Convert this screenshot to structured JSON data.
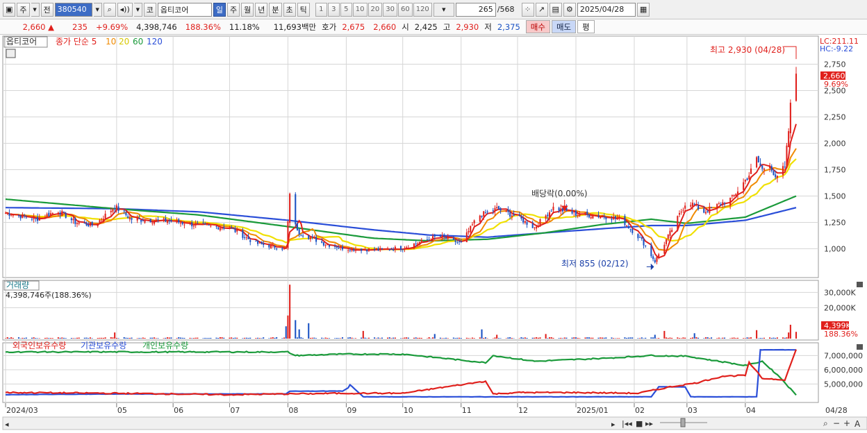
{
  "toolbar": {
    "type_label": "주",
    "prev_label": "전",
    "stock_code": "380540",
    "market_label": "코",
    "stock_name": "옵티코어",
    "periods": [
      "일",
      "주",
      "월",
      "년",
      "분",
      "초",
      "틱"
    ],
    "active_period": "일",
    "intervals": [
      "1",
      "3",
      "5",
      "10",
      "20",
      "30",
      "60",
      "120"
    ],
    "count_display": "265",
    "count_total": "/568",
    "date": "2025/04/28"
  },
  "quote": {
    "price": "2,660",
    "change": "235",
    "change_pct": "+9.69%",
    "volume": "4,398,746",
    "volume_ratio": "188.36%",
    "turnover": "11.18%",
    "amount": "11,693백만",
    "bid_label": "호가",
    "bid": "2,675",
    "ask": "2,660",
    "open_label": "시",
    "open": "2,425",
    "high_label": "고",
    "high": "2,930",
    "low_label": "저",
    "low": "2,375",
    "buy_label": "매수",
    "sell_label": "매도",
    "avg_label": "평"
  },
  "chart_data": [
    {
      "type": "candlestick",
      "title": "옵티코어",
      "legend": [
        {
          "name": "종가 단순 5",
          "color": "#e0201c"
        },
        {
          "name": "10",
          "color": "#f08a00"
        },
        {
          "name": "20",
          "color": "#f0e000"
        },
        {
          "name": "60",
          "color": "#1a9a3a"
        },
        {
          "name": "120",
          "color": "#2a4ed8"
        }
      ],
      "ylim": [
        740,
        2990
      ],
      "yticks": [
        "1,000",
        "1,250",
        "1,500",
        "1,750",
        "2,000",
        "2,250",
        "2,500",
        "2,750"
      ],
      "price_marker": "2,660",
      "pct_marker": "9.69%",
      "lc_label": "LC:211.11",
      "hc_label": "HC:-9.22",
      "annotations": {
        "high": "최고 2,930 (04/28)",
        "low": "최저 855 (02/12)",
        "dividend": "배당락(0.00%)"
      },
      "close_anchors": {
        "2024/03/04": 1340,
        "2024/03/20": 1280,
        "2024/04/01": 1360,
        "2024/04/10": 1250,
        "2024/04/20": 1220,
        "2024/05/01": 1400,
        "2024/05/10": 1280,
        "2024/06/01": 1260,
        "2024/06/15": 1220,
        "2024/07/01": 1200,
        "2024/07/15": 1050,
        "2024/07/31": 1000,
        "2024/08/02": 1500,
        "2024/08/06": 1160,
        "2024/08/20": 1050,
        "2024/09/01": 1000,
        "2024/09/20": 990,
        "2024/10/01": 1010,
        "2024/10/20": 1120,
        "2024/11/01": 1050,
        "2024/11/10": 1310,
        "2024/11/20": 1380,
        "2024/12/01": 1300,
        "2024/12/10": 1200,
        "2024/12/20": 1390,
        "2025/01/01": 1330,
        "2025/01/15": 1310,
        "2025/01/25": 1280,
        "2025/02/05": 1080,
        "2025/02/12": 880,
        "2025/02/20": 1150,
        "2025/03/01": 1460,
        "2025/03/10": 1350,
        "2025/03/25": 1480,
        "2025/04/03": 1700,
        "2025/04/07": 1850,
        "2025/04/10": 1750,
        "2025/04/14": 1820,
        "2025/04/17": 1650,
        "2025/04/22": 1780,
        "2025/04/24": 2120,
        "2025/04/25": 2425,
        "2025/04/28": 2660
      },
      "ma_anchors": {
        "ma60": {
          "2024/03/04": 1470,
          "2024/05/01": 1380,
          "2024/06/15": 1320,
          "2024/08/01": 1210,
          "2024/09/15": 1100,
          "2024/10/15": 1075,
          "2024/11/15": 1090,
          "2024/12/15": 1150,
          "2025/01/15": 1230,
          "2025/02/10": 1280,
          "2025/03/01": 1240,
          "2025/04/01": 1300,
          "2025/04/28": 1500
        },
        "ma120": {
          "2024/03/04": 1390,
          "2024/05/01": 1380,
          "2024/06/15": 1350,
          "2024/08/01": 1270,
          "2024/09/15": 1180,
          "2024/10/15": 1130,
          "2024/11/15": 1110,
          "2024/12/15": 1150,
          "2025/01/15": 1190,
          "2025/02/10": 1220,
          "2025/03/01": 1220,
          "2025/04/01": 1270,
          "2025/04/28": 1390
        }
      }
    },
    {
      "type": "bar",
      "title": "거래량",
      "summary": "4,398,746주(188.36%)",
      "yticks": [
        "20,000K",
        "30,000K"
      ],
      "ylim": [
        0,
        36000
      ],
      "latest_label": "4,399K",
      "latest_pct": "188.36%",
      "spikes": {
        "2024/05/01": 4000,
        "2024/07/31": 8000,
        "2024/08/01": 15000,
        "2024/08/02": 35000,
        "2024/08/05": 12000,
        "2024/08/07": 6000,
        "2024/08/12": 10000,
        "2024/09/10": 5000,
        "2024/10/18": 3000,
        "2024/11/12": 6000,
        "2024/11/20": 2500,
        "2024/12/16": 3000,
        "2025/02/12": 2500,
        "2025/02/17": 5000,
        "2025/03/05": 3500,
        "2025/04/07": 5500,
        "2025/04/24": 4000,
        "2025/04/25": 9000,
        "2025/04/28": 4399
      },
      "base_volume": 700
    },
    {
      "type": "line",
      "series": [
        {
          "name": "외국인보유수량",
          "color": "#e0201c"
        },
        {
          "name": "기관보유수량",
          "color": "#2a4ed8"
        },
        {
          "name": "개인보유수량",
          "color": "#1a9a3a"
        }
      ],
      "yticks": [
        "5,000,000",
        "6,000,000",
        "7,000,000"
      ],
      "ylim": [
        3800000,
        7700000
      ],
      "anchors": {
        "foreign": {
          "2024/03/04": 4400000,
          "2024/05/01": 4350000,
          "2024/07/01": 4250000,
          "2024/08/01": 4300000,
          "2024/09/01": 4350000,
          "2024/10/01": 4350000,
          "2024/11/14": 5200000,
          "2024/11/18": 4300000,
          "2024/12/01": 4400000,
          "2025/01/01": 4400000,
          "2025/02/03": 4350000,
          "2025/02/20": 4800000,
          "2025/03/05": 5050000,
          "2025/03/20": 5550000,
          "2025/04/01": 5600000,
          "2025/04/03": 6500000,
          "2025/04/10": 5400000,
          "2025/04/22": 5300000,
          "2025/04/28": 7400000
        },
        "institution": {
          "2024/03/04": 4250000,
          "2024/05/01": 4300000,
          "2024/07/01": 4300000,
          "2024/07/31": 4300000,
          "2024/08/02": 4500000,
          "2024/09/01": 4500000,
          "2024/09/03": 4950000,
          "2024/09/10": 4100000,
          "2024/11/01": 4100000,
          "2025/01/01": 4100000,
          "2025/02/10": 4100000,
          "2025/02/14": 4800000,
          "2025/02/28": 4800000,
          "2025/03/03": 4100000,
          "2025/04/07": 4100000,
          "2025/04/09": 7400000,
          "2025/04/28": 7400000
        },
        "individual": {
          "2024/03/04": 7250000,
          "2024/05/01": 7250000,
          "2024/07/01": 7250000,
          "2024/08/01": 7250000,
          "2024/08/05": 7000000,
          "2024/09/01": 7100000,
          "2024/10/01": 7100000,
          "2024/11/14": 6500000,
          "2024/11/18": 7000000,
          "2024/12/10": 6600000,
          "2025/01/15": 6800000,
          "2025/02/10": 7000000,
          "2025/03/01": 6950000,
          "2025/04/01": 6300000,
          "2025/04/10": 6600000,
          "2025/04/20": 5400000,
          "2025/04/28": 4200000
        }
      }
    }
  ],
  "x_axis": {
    "labels": [
      "2024/03",
      "05",
      "06",
      "07",
      "08",
      "09",
      "10",
      "11",
      "12",
      "2025/01",
      "02",
      "03",
      "04"
    ],
    "label_dates": [
      "2024/03/04",
      "2024/05/02",
      "2024/06/01",
      "2024/07/01",
      "2024/08/01",
      "2024/09/01",
      "2024/10/01",
      "2024/11/01",
      "2024/12/01",
      "2025/01/01",
      "2025/02/01",
      "2025/03/01",
      "2025/04/01"
    ],
    "current_label": "04/28",
    "start": "2024/03/04",
    "end": "2025/04/28"
  },
  "colors": {
    "up": "#e0201c",
    "down": "#1a52c4",
    "grid": "#d4d4d4"
  }
}
